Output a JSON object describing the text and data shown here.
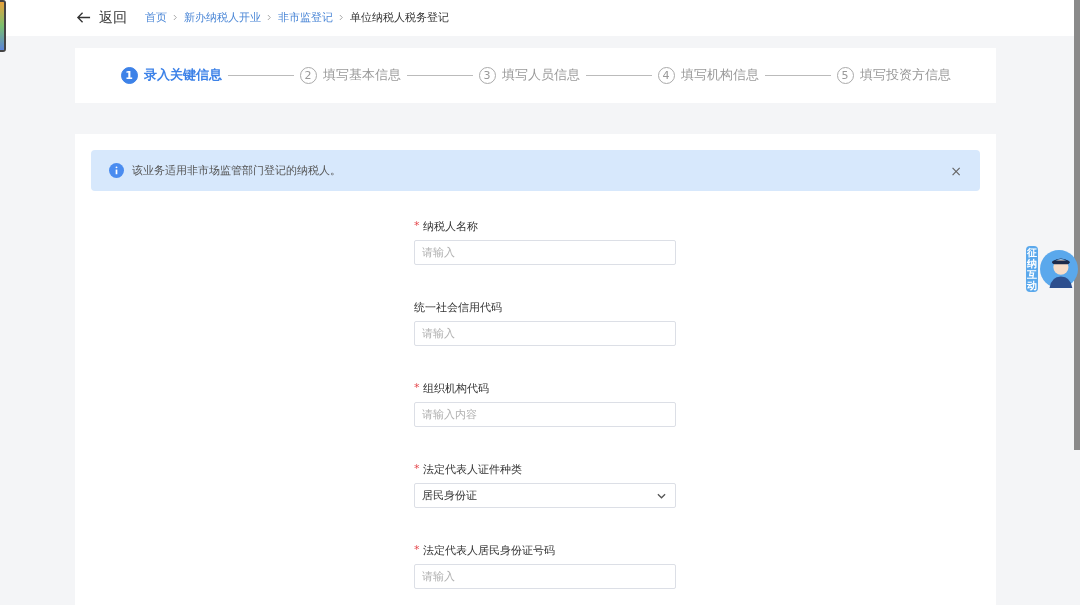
{
  "header": {
    "back": "返回",
    "breadcrumbs": [
      {
        "label": "首页",
        "link": true
      },
      {
        "label": "新办纳税人开业",
        "link": true
      },
      {
        "label": "非市监登记",
        "link": true
      },
      {
        "label": "单位纳税人税务登记",
        "link": false
      }
    ]
  },
  "steps": [
    {
      "number": "1",
      "label": "录入关键信息",
      "selected": true
    },
    {
      "number": "2",
      "label": "填写基本信息",
      "selected": false
    },
    {
      "number": "3",
      "label": "填写人员信息",
      "selected": false
    },
    {
      "number": "4",
      "label": "填写机构信息",
      "selected": false
    },
    {
      "number": "5",
      "label": "填写投资方信息",
      "selected": false
    }
  ],
  "alert": {
    "text": "该业务适用非市场监管部门登记的纳税人。",
    "close": "×"
  },
  "fields": [
    {
      "kind": "input",
      "required_mark": "*",
      "label": "纳税人名称",
      "placeholder": "请输入"
    },
    {
      "kind": "input",
      "label": "统一社会信用代码",
      "placeholder": "请输入"
    },
    {
      "kind": "input",
      "required_mark": "*",
      "label": "组织机构代码",
      "placeholder": "请输入内容"
    },
    {
      "kind": "select",
      "required_mark": "*",
      "label": "法定代表人证件种类",
      "value": "居民身份证"
    },
    {
      "kind": "input",
      "required_mark": "*",
      "label": "法定代表人居民身份证号码",
      "placeholder": "请输入"
    }
  ],
  "assistant": {
    "text": "征纳互动"
  }
}
